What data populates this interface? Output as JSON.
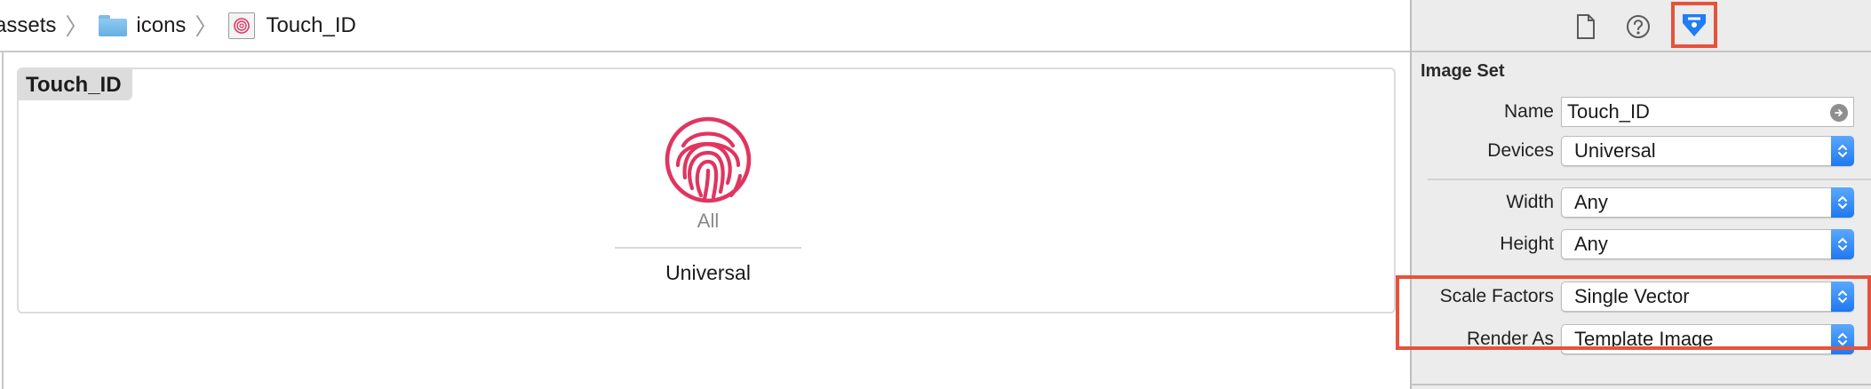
{
  "jumpbar": {
    "items": [
      {
        "label": "assets",
        "icon": "none"
      },
      {
        "label": "icons",
        "icon": "folder-icon"
      },
      {
        "label": "Touch_ID",
        "icon": "image-set-icon"
      }
    ],
    "separator": "〉"
  },
  "canvas": {
    "set_name": "Touch_ID",
    "slot": {
      "icon": "fingerprint-icon",
      "scale_label": "All",
      "device_label": "Universal"
    },
    "icon_color": "#e03560"
  },
  "inspector": {
    "toolbar": {
      "file_inspector_icon": "file-icon",
      "help_icon": "question-icon",
      "attributes_icon": "attributes-inspector-icon",
      "selected": "attributes"
    },
    "section_title": "Image Set",
    "name": {
      "label": "Name",
      "value": "Touch_ID"
    },
    "devices": {
      "label": "Devices",
      "value": "Universal"
    },
    "width": {
      "label": "Width",
      "value": "Any"
    },
    "height": {
      "label": "Height",
      "value": "Any"
    },
    "scale_factors": {
      "label": "Scale Factors",
      "value": "Single Vector"
    },
    "render_as": {
      "label": "Render As",
      "value": "Template Image"
    }
  },
  "colors": {
    "highlight": "#e5533d",
    "accent_blue": "#1f78f0",
    "panel_bg": "#ececec"
  }
}
